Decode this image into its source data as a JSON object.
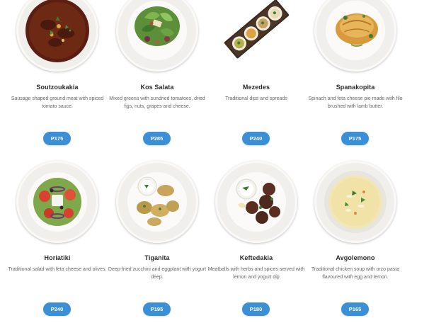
{
  "menu": {
    "items": [
      {
        "name": "Soutzoukakia",
        "description": "Sausage shaped ground meat with spiced tomato sauce.",
        "price": "P175",
        "image_icon": "soutzoukakia-dish-icon"
      },
      {
        "name": "Kos Salata",
        "description": "Mixed greens with sundried tomatoes, dried figs, nuts, grapes and cheese.",
        "price": "P285",
        "image_icon": "kos-salata-dish-icon"
      },
      {
        "name": "Mezedes",
        "description": "Traditional dips and spreads",
        "price": "P240",
        "image_icon": "mezedes-board-icon"
      },
      {
        "name": "Spanakopita",
        "description": "Spinach and feta cheese pie made with filo brushed with lamb butter.",
        "price": "P175",
        "image_icon": "spanakopita-dish-icon"
      },
      {
        "name": "Horiatiki",
        "description": "Traditional salad with feta cheese and olives.",
        "price": "P240",
        "image_icon": "horiatiki-dish-icon"
      },
      {
        "name": "Tiganita",
        "description": "Deep-fried zucchini and eggplant with yogurt deep.",
        "price": "P195",
        "image_icon": "tiganita-dish-icon"
      },
      {
        "name": "Keftedakia",
        "description": "Meatballs with herbs and spices served with lemon and yogurt dip",
        "price": "P180",
        "image_icon": "keftedakia-dish-icon"
      },
      {
        "name": "Avgolemono",
        "description": "Traditional chicken soup with orzo pasta flavoured with egg and lemon.",
        "price": "P165",
        "image_icon": "avgolemono-soup-icon"
      }
    ]
  },
  "colors": {
    "price_button": "#3a8fd6",
    "title_text": "#2b2b2b",
    "description_text": "#666666"
  }
}
